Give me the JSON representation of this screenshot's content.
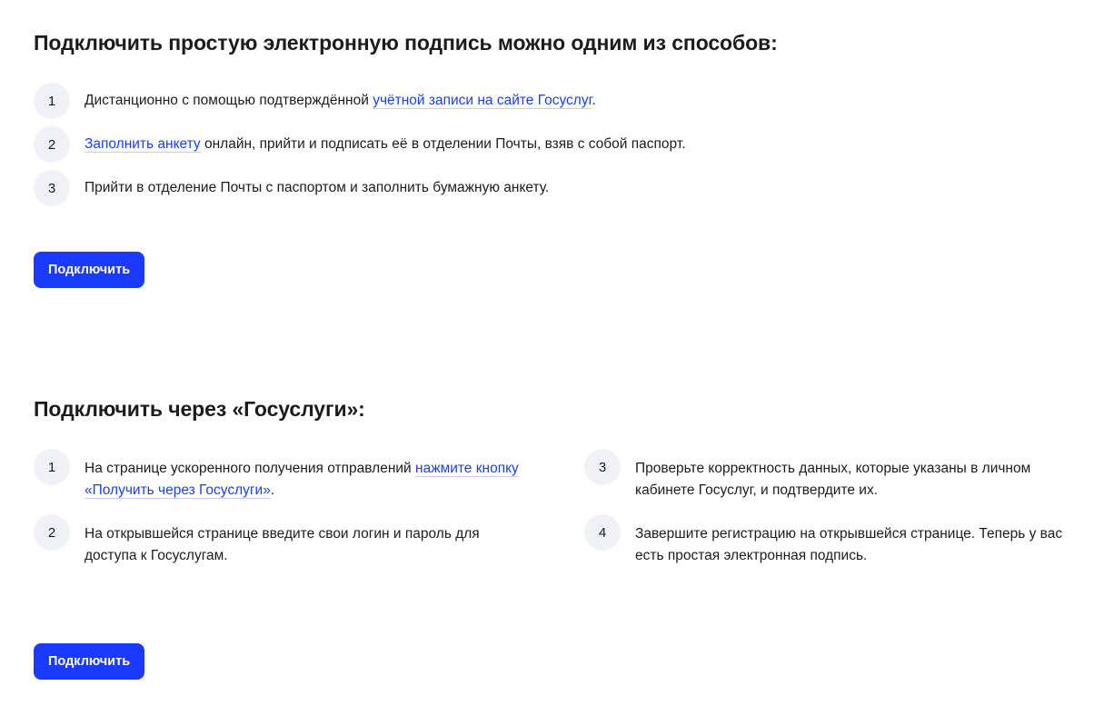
{
  "section1": {
    "heading": "Подключить простую электронную подпись можно одним из способов:",
    "steps": [
      {
        "num": "1",
        "before": "Дистанционно с помощью подтверждённой ",
        "link": "учётной записи на сайте Госуслуг",
        "after": "."
      },
      {
        "num": "2",
        "before": "",
        "link": "Заполнить анкету",
        "after": " онлайн, прийти и подписать её в отделении Почты, взяв с собой паспорт."
      },
      {
        "num": "3",
        "text": "Прийти в отделение Почты с паспортом и заполнить бумажную анкету."
      }
    ],
    "button": "Подключить"
  },
  "section2": {
    "heading": "Подключить через «Госуслуги»:",
    "steps": [
      {
        "num": "1",
        "before": "На странице ускоренного получения отправлений ",
        "link": "нажмите кнопку «Получить через Госуслуги»",
        "after": "."
      },
      {
        "num": "2",
        "text": "На открывшейся странице введите свои логин и пароль для доступа к Госуслугам."
      },
      {
        "num": "3",
        "text": "Проверьте корректность данных, которые указаны в личном кабинете Госуслуг, и подтвердите их."
      },
      {
        "num": "4",
        "text": "Завершите регистрацию на открывшейся странице. Теперь у вас есть простая электронная подпись."
      }
    ],
    "button": "Подключить"
  }
}
